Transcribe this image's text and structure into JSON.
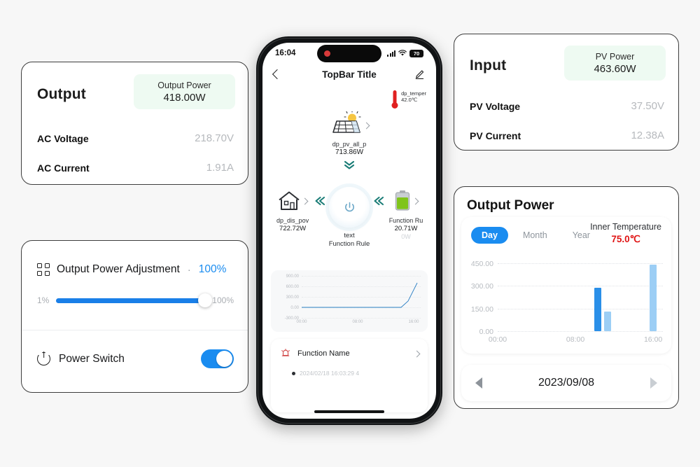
{
  "output_card": {
    "title": "Output",
    "badge": {
      "label": "Output Power",
      "value": "418.00W"
    },
    "rows": [
      {
        "label": "AC Voltage",
        "value": "218.70V"
      },
      {
        "label": "AC Current",
        "value": "1.91A"
      }
    ]
  },
  "input_card": {
    "title": "Input",
    "badge": {
      "label": "PV Power",
      "value": "463.60W"
    },
    "rows": [
      {
        "label": "PV Voltage",
        "value": "37.50V"
      },
      {
        "label": "PV Current",
        "value": "12.38A"
      }
    ]
  },
  "adjustment_card": {
    "icon": "grid-icon",
    "label": "Output Power Adjustment",
    "separator": "·",
    "percent": "100%",
    "slider": {
      "min_label": "1%",
      "max_label": "100%",
      "value": 100
    }
  },
  "switch_card": {
    "icon": "power-icon",
    "label": "Power Switch",
    "state": "on"
  },
  "chart_card": {
    "title": "Output Power",
    "tabs": [
      {
        "label": "Day",
        "active": true
      },
      {
        "label": "Month",
        "active": false
      },
      {
        "label": "Year",
        "active": false
      }
    ],
    "inner_temperature": {
      "label": "Inner Temperature",
      "value": "75.0℃"
    },
    "date_nav": {
      "prev": "prev-arrow",
      "date": "2023/09/08",
      "next": "next-arrow"
    }
  },
  "chart_data": {
    "type": "bar",
    "title": "Output Power",
    "xlabel": "",
    "ylabel": "",
    "ylim": [
      0,
      450
    ],
    "yticks": [
      "0.00",
      "150.00",
      "300.00",
      "450.00"
    ],
    "xticks": [
      "00:00",
      "08:00",
      "16:00"
    ],
    "xlim_hours": [
      0,
      17
    ],
    "grid": true,
    "legend": "none",
    "points": [
      {
        "x_hour": 10.3,
        "value": 290,
        "color": "#2a8fe8"
      },
      {
        "x_hour": 11.3,
        "value": 130,
        "color": "#9ccef5"
      },
      {
        "x_hour": 16.0,
        "value": 440,
        "color": "#9ccef5"
      }
    ]
  },
  "phone": {
    "status_bar": {
      "time": "16:04",
      "signal_icon": "signal-bars-icon",
      "wifi_icon": "wifi-icon",
      "battery_level": "70"
    },
    "top_bar": {
      "back_icon": "back-chevron-icon",
      "title": "TopBar Title",
      "edit_icon": "edit-pencil-icon"
    },
    "temperature_chip": {
      "icon": "thermometer-icon",
      "label": "dp_temper",
      "value": "42.0℃"
    },
    "pv_node": {
      "icon": "solar-panel-icon",
      "chevron": "chevron-right-icon",
      "label": "dp_pv_all_p",
      "value": "713.86W",
      "flow_icon": "double-chevron-down-icon"
    },
    "flow": {
      "left_node": {
        "icon": "house-icon",
        "chevron": "chevron-right-icon",
        "label": "dp_dis_pov",
        "value": "722.72W"
      },
      "left_flow_icon": "double-chevron-left-icon",
      "center_node": {
        "icon": "power-button-icon",
        "line1": "text",
        "line2": "Function Rule"
      },
      "right_flow_icon": "double-chevron-left-icon",
      "right_node": {
        "icon": "battery-icon",
        "chevron": "chevron-right-icon",
        "label": "Function Ru",
        "value": "20.71W",
        "extra": "0W"
      }
    },
    "mini_chart": {
      "type": "line",
      "yticks": [
        "900.00",
        "600.00",
        "300.00",
        "0.00",
        "-300.00"
      ],
      "xticks": [
        "00:00",
        "08:00",
        "16:00"
      ],
      "ylim": [
        -300,
        900
      ],
      "line_color": "#2a7fc4",
      "series": [
        {
          "x_hour": 0.0,
          "value": 0
        },
        {
          "x_hour": 8.0,
          "value": 0
        },
        {
          "x_hour": 14.2,
          "value": 0
        },
        {
          "x_hour": 15.2,
          "value": 180
        },
        {
          "x_hour": 16.5,
          "value": 700
        }
      ]
    },
    "function_card": {
      "icon": "alarm-icon",
      "title": "Function Name",
      "chevron": "chevron-right-icon",
      "log_entry": "2024/02/18 16:03:29 4"
    },
    "home_indicator": "home-indicator"
  },
  "colors": {
    "accent_blue": "#1a8cf0",
    "badge_green_bg": "#eefaf2",
    "temp_red": "#e01414",
    "bar_dark": "#2a8fe8",
    "bar_light": "#9ccef5",
    "flow_teal": "#1b7d77"
  }
}
